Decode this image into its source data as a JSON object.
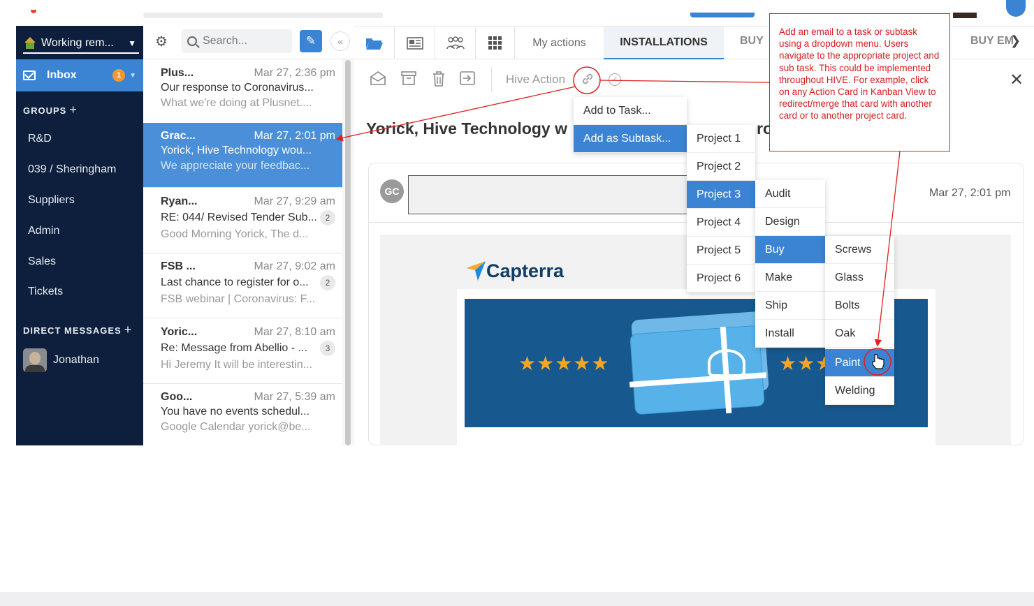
{
  "sidebar": {
    "workspace": "Working rem...",
    "inbox_label": "Inbox",
    "inbox_badge": "1",
    "groups_label": "GROUPS",
    "groups": [
      "R&D",
      "039 / Sheringham",
      "Suppliers",
      "Admin",
      "Sales",
      "Tickets"
    ],
    "dm_label": "DIRECT MESSAGES",
    "dm_user": "Jonathan"
  },
  "list": {
    "search_placeholder": "Search...",
    "messages": [
      {
        "from": "Plus...",
        "date": "Mar 27, 2:36 pm",
        "subject": "Our response to Coronavirus...",
        "preview": "What we're doing at Plusnet....",
        "count": ""
      },
      {
        "from": "Grac...",
        "date": "Mar 27, 2:01 pm",
        "subject": "Yorick, Hive Technology wou...",
        "preview": "We appreciate your feedbac...",
        "count": ""
      },
      {
        "from": "Ryan...",
        "date": "Mar 27, 9:29 am",
        "subject": "RE: 044/ Revised Tender Sub...",
        "preview": "Good Morning Yorick, The d...",
        "count": "2"
      },
      {
        "from": "FSB ...",
        "date": "Mar 27, 9:02 am",
        "subject": "Last chance to register for o...",
        "preview": "FSB webinar | Coronavirus: F...",
        "count": "2"
      },
      {
        "from": "Yoric...",
        "date": "Mar 27, 8:10 am",
        "subject": "Re: Message from Abellio - ...",
        "preview": "Hi Jeremy It will be interestin...",
        "count": "3"
      },
      {
        "from": "Goo...",
        "date": "Mar 27, 5:39 am",
        "subject": "You have no events schedul...",
        "preview": "Google Calendar yorick@be...",
        "count": ""
      }
    ]
  },
  "tabs": {
    "my_actions": "My actions",
    "installations": "INSTALLATIONS",
    "buy_partial": "BUY",
    "buy_em": "BUY EM"
  },
  "toolbar": {
    "hive_action": "Hive Action"
  },
  "email": {
    "subject": "Yorick, Hive Technology w",
    "subject_tail": "ro",
    "avatar": "GC",
    "date": "Mar 27, 2:01 pm",
    "brand": "Capterra",
    "stars_left": "★★★★★",
    "stars_right": "★★★"
  },
  "menus": {
    "level1": [
      "Add to Task...",
      "Add as Subtask..."
    ],
    "projects": [
      "Project 1",
      "Project 2",
      "Project 3",
      "Project 4",
      "Project 5",
      "Project 6"
    ],
    "phases": [
      "Audit",
      "Design",
      "Buy",
      "Make",
      "Ship",
      "Install"
    ],
    "items": [
      "Screws",
      "Glass",
      "Bolts",
      "Oak",
      "Paint",
      "Welding"
    ]
  },
  "annotation": {
    "text": "Add an email to a task or subtask using a dropdown menu. Users navigate to the appropriate project and sub task. This could be implemented throughout HIVE. For example, click on any Action Card in Kanban View to redirect/merge that card with another card or to another project card."
  },
  "colors": {
    "sidebar_bg": "#0d1f3c",
    "accent": "#3b84d4",
    "annotation": "#e02020",
    "badge": "#f39a2d"
  }
}
